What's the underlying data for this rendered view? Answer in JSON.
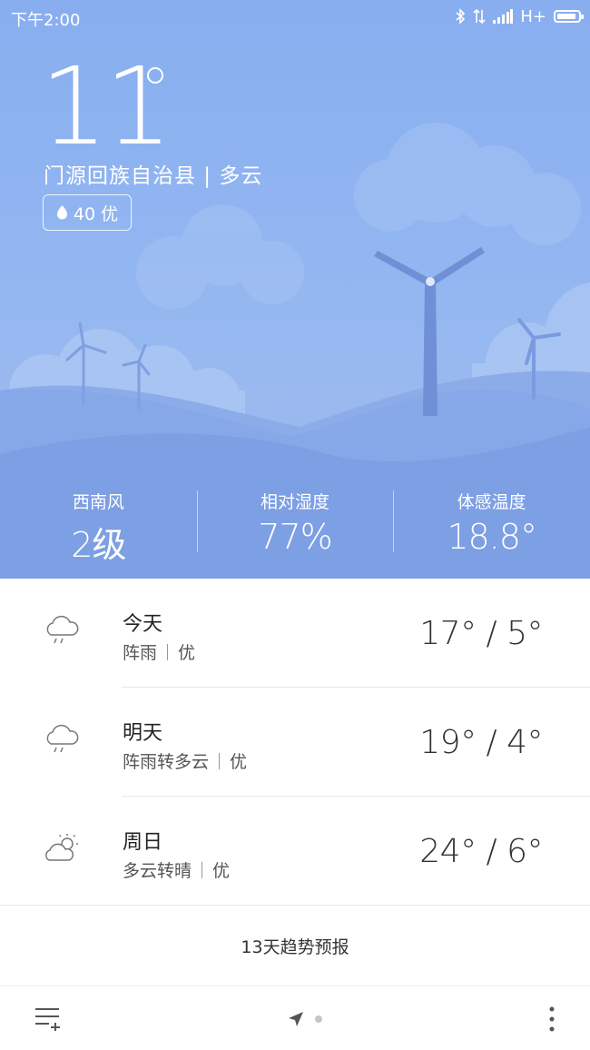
{
  "status_bar": {
    "time": "下午2:00",
    "network": "H+",
    "icons": [
      "bluetooth-icon",
      "data-transfer-icon",
      "signal-icon",
      "battery-icon"
    ]
  },
  "current": {
    "temperature": "11",
    "location_condition": "门源回族自治县 | 多云",
    "aqi": "40 优"
  },
  "stats": [
    {
      "label": "西南风",
      "value": "2级"
    },
    {
      "label": "相对湿度",
      "value": "77%"
    },
    {
      "label": "体感温度",
      "value": "18.8°"
    }
  ],
  "forecast": [
    {
      "day": "今天",
      "condition": "阵雨",
      "quality": "优",
      "temps": "17° / 5°",
      "icon": "rain-cloud-icon"
    },
    {
      "day": "明天",
      "condition": "阵雨转多云",
      "quality": "优",
      "temps": "19° / 4°",
      "icon": "rain-cloud-icon"
    },
    {
      "day": "周日",
      "condition": "多云转晴",
      "quality": "优",
      "temps": "24° / 6°",
      "icon": "partly-cloudy-icon"
    }
  ],
  "trend_label": "13天趋势预报",
  "colors": {
    "sky_top": "#88aef0",
    "hill_dark": "#7a9ce0",
    "turbine": "#6f8fd6"
  }
}
